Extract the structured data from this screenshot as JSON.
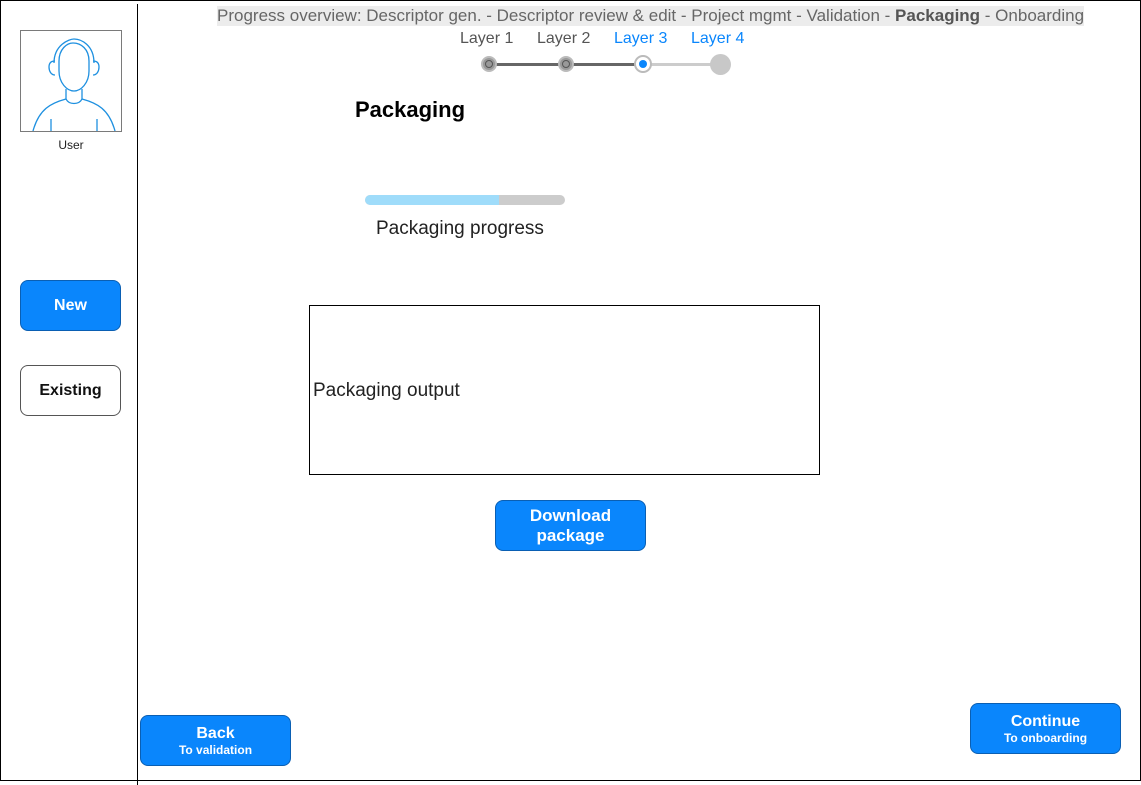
{
  "sidebar": {
    "avatar_label": "User",
    "new_label": "New",
    "existing_label": "Existing"
  },
  "progress_overview": {
    "prefix": "Progress overview: Descriptor gen. - Descriptor review & edit - Project mgmt - Validation - ",
    "current": "Packaging",
    "suffix": " - Onboarding"
  },
  "layers": [
    {
      "label": "Layer 1",
      "state": "done"
    },
    {
      "label": "Layer 2",
      "state": "done"
    },
    {
      "label": "Layer 3",
      "state": "current"
    },
    {
      "label": "Layer 4",
      "state": "upcoming"
    }
  ],
  "main": {
    "title": "Packaging",
    "progress_label": "Packaging progress",
    "progress_value": 0.67,
    "output_text": "Packaging output",
    "download_line1": "Download",
    "download_line2": "package"
  },
  "footer": {
    "back_label": "Back",
    "back_sub": "To validation",
    "continue_label": "Continue",
    "continue_sub": "To onboarding"
  },
  "colors": {
    "accent": "#0a86fc",
    "progress_fill": "#9fdcfa",
    "progress_track": "#cccccc",
    "layer_active_text": "#0a86fc",
    "layer_done_text": "#555555"
  }
}
